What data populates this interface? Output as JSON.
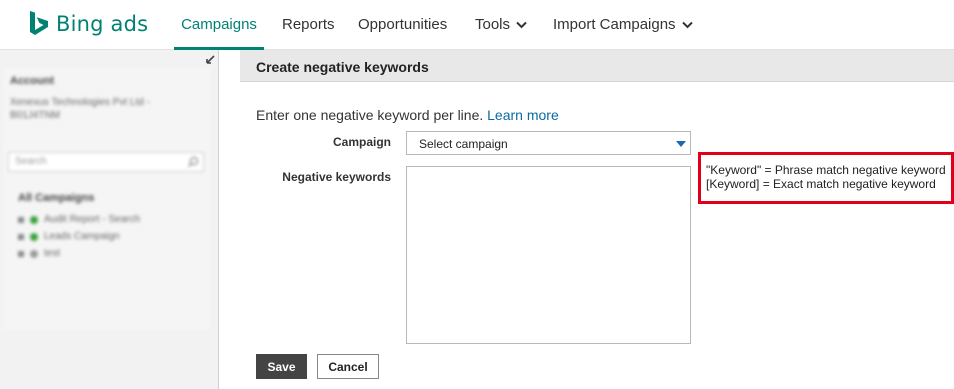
{
  "brand": {
    "name": "Bing ads",
    "color": "#008272"
  },
  "nav": {
    "items": [
      {
        "label": "Campaigns",
        "active": true
      },
      {
        "label": "Reports"
      },
      {
        "label": "Opportunities"
      },
      {
        "label": "Tools",
        "dropdown": true
      },
      {
        "label": "Import Campaigns",
        "dropdown": true
      }
    ]
  },
  "sidebar": {
    "account_label": "Account",
    "account_name": "Xenexus Technologies Pvt Ltd - B01J4TNM",
    "search_placeholder": "Search",
    "all_campaigns_label": "All Campaigns",
    "campaigns": [
      {
        "label": "Audit Report - Search",
        "status_color": "#3aa13a"
      },
      {
        "label": "Leads Campaign",
        "status_color": "#3aa13a"
      },
      {
        "label": "test",
        "status_color": "#999999"
      }
    ],
    "icons": {
      "collapse": "collapse-arrow-icon",
      "search": "search-icon"
    }
  },
  "main": {
    "title": "Create negative keywords",
    "instruction": "Enter one negative keyword per line.",
    "learn_more": "Learn more",
    "campaign_label": "Campaign",
    "campaign_select_value": "Select campaign",
    "negative_keywords_label": "Negative keywords",
    "negative_keywords_value": "",
    "hint_lines": [
      "\"Keyword\" = Phrase match negative keyword",
      "[Keyword] = Exact match negative keyword"
    ],
    "hint_border_color": "#e0001b",
    "save_label": "Save",
    "cancel_label": "Cancel"
  }
}
